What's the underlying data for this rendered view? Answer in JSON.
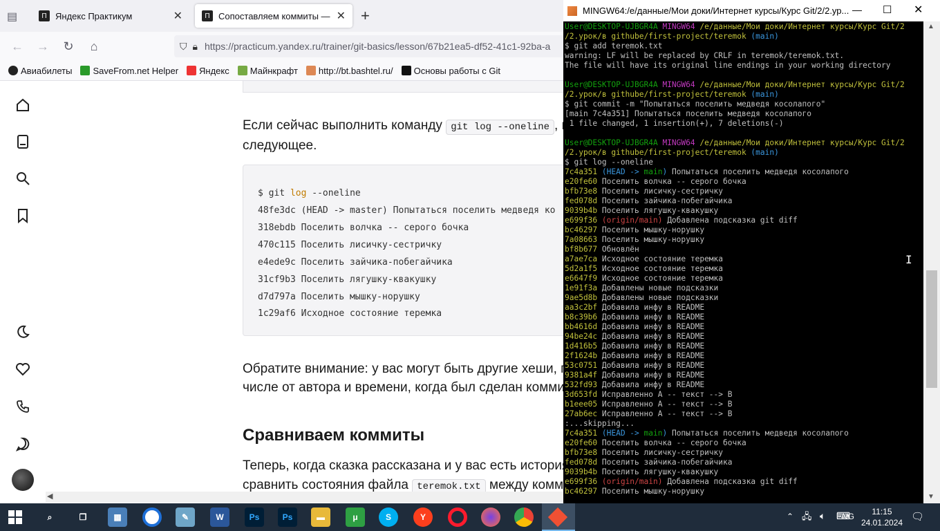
{
  "browser": {
    "tabs": [
      {
        "title": "Яндекс Практикум"
      },
      {
        "title": "Сопоставляем коммиты — Янд"
      }
    ],
    "url": "https://practicum.yandex.ru/trainer/git-basics/lesson/67b21ea5-df52-41c1-92ba-a",
    "bookmarks": [
      "Авиабилеты",
      "SaveFrom.net Helper",
      "Яндекс",
      "Майнкрафт",
      "http://bt.bashtel.ru/",
      "Основы работы с Git"
    ]
  },
  "page": {
    "p1_a": "Если сейчас выполнить команду",
    "p1_code": "git log --oneline",
    "p1_b": ", по",
    "p1_c": "следующее.",
    "code": {
      "prompt": "$ git",
      "cmd": "log",
      "args": "--oneline",
      "lines": [
        "48fe3dc (HEAD -> master) Попытаться поселить медведя ко",
        "318ebdb Поселить волчка -- серого бочка",
        "470c115 Поселить лисичку-сестричку",
        "e4ede9c Поселить зайчика-побегайчика",
        "31cf9b3 Поселить лягушку-квакушку",
        "d7d797a Поселить мышку-норушку",
        "1c29af6 Исходное состояние теремка"
      ]
    },
    "p2_a": "Обратите внимание: у вас могут быть другие хеши, п",
    "p2_b": "числе от автора и времени, когда был сделан коммит",
    "heading": "Сравниваем коммиты",
    "p3_a": "Теперь, когда сказка рассказана и у вас есть история",
    "p3_b": "сравнить состояния файла",
    "p3_code": "teremok.txt",
    "p3_c": "между комми"
  },
  "terminal": {
    "title": "MINGW64:/e/данные/Мои доки/Интернет курсы/Курс Git/2/2.ур...",
    "lines": [
      [
        [
          "g",
          "User@DESKTOP-UJBGR4A "
        ],
        [
          "m",
          "MINGW64 "
        ],
        [
          "y",
          "/e/данные/Мои доки/Интернет курсы/Курс Git/2"
        ]
      ],
      [
        [
          "y",
          "/2.урок/в githube/first-project/teremok "
        ],
        [
          "c",
          "(main)"
        ]
      ],
      [
        [
          "w",
          "$ git add teremok.txt"
        ]
      ],
      [
        [
          "w",
          "warning: LF will be replaced by CRLF in teremok/teremok.txt."
        ]
      ],
      [
        [
          "w",
          "The file will have its original line endings in your working directory"
        ]
      ],
      [
        [
          "w",
          ""
        ]
      ],
      [
        [
          "g",
          "User@DESKTOP-UJBGR4A "
        ],
        [
          "m",
          "MINGW64 "
        ],
        [
          "y",
          "/e/данные/Мои доки/Интернет курсы/Курс Git/2"
        ]
      ],
      [
        [
          "y",
          "/2.урок/в githube/first-project/teremok "
        ],
        [
          "c",
          "(main)"
        ]
      ],
      [
        [
          "w",
          "$ git commit -m \"Попытаться поселить медведя косолапого\""
        ]
      ],
      [
        [
          "w",
          "[main 7c4a351] Попытаться поселить медведя косолапого"
        ]
      ],
      [
        [
          "w",
          " 1 file changed, 1 insertion(+), 7 deletions(-)"
        ]
      ],
      [
        [
          "w",
          ""
        ]
      ],
      [
        [
          "g",
          "User@DESKTOP-UJBGR4A "
        ],
        [
          "m",
          "MINGW64 "
        ],
        [
          "y",
          "/e/данные/Мои доки/Интернет курсы/Курс Git/2"
        ]
      ],
      [
        [
          "y",
          "/2.урок/в githube/first-project/teremok "
        ],
        [
          "c",
          "(main)"
        ]
      ],
      [
        [
          "w",
          "$ git log --oneline"
        ]
      ],
      [
        [
          "y",
          "7c4a351 "
        ],
        [
          "c",
          "(HEAD -> "
        ],
        [
          "g",
          "main"
        ],
        [
          "c",
          ")"
        ],
        [
          "w",
          " Попытаться поселить медведя косолапого"
        ]
      ],
      [
        [
          "y",
          "e20fe60 "
        ],
        [
          "w",
          "Поселить волчка -- серого бочка"
        ]
      ],
      [
        [
          "y",
          "bfb73e8 "
        ],
        [
          "w",
          "Поселить лисичку-сестричку"
        ]
      ],
      [
        [
          "y",
          "fed078d "
        ],
        [
          "w",
          "Поселить зайчика-побегайчика"
        ]
      ],
      [
        [
          "y",
          "9039b4b "
        ],
        [
          "w",
          "Поселить лягушку-квакушку"
        ]
      ],
      [
        [
          "y",
          "e699f36 "
        ],
        [
          "r",
          "(origin/main)"
        ],
        [
          "w",
          " Добавлена подсказка git diff"
        ]
      ],
      [
        [
          "y",
          "bc46297 "
        ],
        [
          "w",
          "Поселить мышку-норушку"
        ]
      ],
      [
        [
          "y",
          "7a08663 "
        ],
        [
          "w",
          "Поселить мышку-норушку"
        ]
      ],
      [
        [
          "y",
          "bf8b677 "
        ],
        [
          "w",
          "Обновлён"
        ]
      ],
      [
        [
          "y",
          "a7ae7ca "
        ],
        [
          "w",
          "Исходное состояние теремка"
        ]
      ],
      [
        [
          "y",
          "5d2a1f5 "
        ],
        [
          "w",
          "Исходное состояние теремка"
        ]
      ],
      [
        [
          "y",
          "e6647f9 "
        ],
        [
          "w",
          "Исходное состояние теремка"
        ]
      ],
      [
        [
          "y",
          "1e91f3a "
        ],
        [
          "w",
          "Добавлены новые подсказки"
        ]
      ],
      [
        [
          "y",
          "9ae5d8b "
        ],
        [
          "w",
          "Добавлены новые подсказки"
        ]
      ],
      [
        [
          "y",
          "aa3c2bf "
        ],
        [
          "w",
          "Добавила инфу в README"
        ]
      ],
      [
        [
          "y",
          "b8c39b6 "
        ],
        [
          "w",
          "Добавила инфу в README"
        ]
      ],
      [
        [
          "y",
          "bb4616d "
        ],
        [
          "w",
          "Добавила инфу в README"
        ]
      ],
      [
        [
          "y",
          "94be24c "
        ],
        [
          "w",
          "Добавила инфу в README"
        ]
      ],
      [
        [
          "y",
          "1d416b5 "
        ],
        [
          "w",
          "Добавила инфу в README"
        ]
      ],
      [
        [
          "y",
          "2f1624b "
        ],
        [
          "w",
          "Добавила инфу в README"
        ]
      ],
      [
        [
          "y",
          "53c0751 "
        ],
        [
          "w",
          "Добавила инфу в README"
        ]
      ],
      [
        [
          "y",
          "9381a4f "
        ],
        [
          "w",
          "Добавила инфу в README"
        ]
      ],
      [
        [
          "y",
          "532fd93 "
        ],
        [
          "w",
          "Добавила инфу в README"
        ]
      ],
      [
        [
          "y",
          "3d653fd "
        ],
        [
          "w",
          "Исправленно А -- текст --> В"
        ]
      ],
      [
        [
          "y",
          "b1eee05 "
        ],
        [
          "w",
          "Исправленно А -- текст --> В"
        ]
      ],
      [
        [
          "y",
          "27ab6ec "
        ],
        [
          "w",
          "Исправленно А -- текст --> В"
        ]
      ],
      [
        [
          "w",
          ":...skipping..."
        ]
      ],
      [
        [
          "y",
          "7c4a351 "
        ],
        [
          "c",
          "(HEAD -> "
        ],
        [
          "g",
          "main"
        ],
        [
          "c",
          ")"
        ],
        [
          "w",
          " Попытаться поселить медведя косолапого"
        ]
      ],
      [
        [
          "y",
          "e20fe60 "
        ],
        [
          "w",
          "Поселить волчка -- серого бочка"
        ]
      ],
      [
        [
          "y",
          "bfb73e8 "
        ],
        [
          "w",
          "Поселить лисичку-сестричку"
        ]
      ],
      [
        [
          "y",
          "fed078d "
        ],
        [
          "w",
          "Поселить зайчика-побегайчика"
        ]
      ],
      [
        [
          "y",
          "9039b4b "
        ],
        [
          "w",
          "Поселить лягушку-квакушку"
        ]
      ],
      [
        [
          "y",
          "e699f36 "
        ],
        [
          "r",
          "(origin/main)"
        ],
        [
          "w",
          " Добавлена подсказка git diff"
        ]
      ],
      [
        [
          "y",
          "bc46297 "
        ],
        [
          "w",
          "Поселить мышку-норушку"
        ]
      ]
    ]
  },
  "taskbar": {
    "lang": "ENG",
    "time": "11:15",
    "date": "24.01.2024"
  }
}
